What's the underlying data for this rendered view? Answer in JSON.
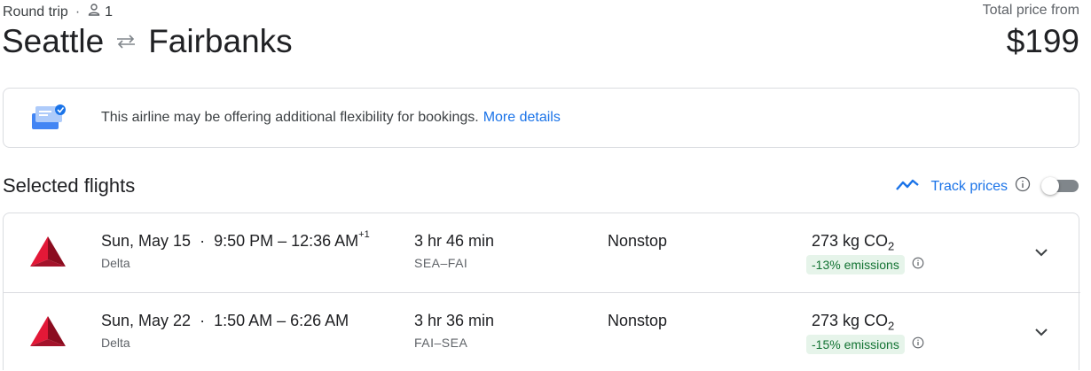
{
  "header": {
    "trip_type": "Round trip",
    "separator": "·",
    "passengers_icon": "person-icon",
    "passengers": "1",
    "origin": "Seattle",
    "swap_icon": "swap-arrows-icon",
    "destination": "Fairbanks",
    "total_label": "Total price from",
    "total_price": "$199"
  },
  "banner": {
    "icon": "ticket-flexibility-icon",
    "text": "This airline may be offering additional flexibility for bookings.",
    "link": "More details"
  },
  "selected": {
    "title": "Selected flights",
    "track_icon": "trend-line-icon",
    "track_label": "Track prices",
    "info_icon": "info-icon",
    "track_enabled": false
  },
  "flights": [
    {
      "date": "Sun, May 15",
      "dot": "·",
      "times": "9:50 PM – 12:36 AM",
      "day_offset": "+1",
      "airline": "Delta",
      "duration": "3 hr 46 min",
      "route": "SEA–FAI",
      "stops": "Nonstop",
      "co2_value": "273 kg CO",
      "co2_sub": "2",
      "emissions": "-13% emissions"
    },
    {
      "date": "Sun, May 22",
      "dot": "·",
      "times": "1:50 AM – 6:26 AM",
      "day_offset": "",
      "airline": "Delta",
      "duration": "3 hr 36 min",
      "route": "FAI–SEA",
      "stops": "Nonstop",
      "co2_value": "273 kg CO",
      "co2_sub": "2",
      "emissions": "-15% emissions"
    }
  ],
  "colors": {
    "accent": "#1a73e8",
    "delta_red": "#c8102e",
    "emission_bg": "#e6f4ea",
    "emission_text": "#137333"
  }
}
